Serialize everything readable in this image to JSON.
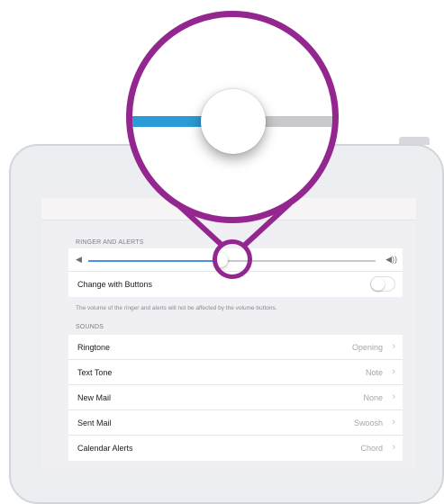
{
  "colors": {
    "accent": "#93278f",
    "slider_fill": "#4a90e2",
    "slider_track": "#c7c7cc"
  },
  "settings": {
    "ringer_header": "RINGER AND ALERTS",
    "volume_level": 0.46,
    "change_with_buttons_label": "Change with Buttons",
    "change_with_buttons_on": false,
    "footer_note": "The volume of the ringer and alerts will not be affected by the volume buttons.",
    "sounds_header": "SOUNDS",
    "sounds": [
      {
        "label": "Ringtone",
        "value": "Opening"
      },
      {
        "label": "Text Tone",
        "value": "Note"
      },
      {
        "label": "New Mail",
        "value": "None"
      },
      {
        "label": "Sent Mail",
        "value": "Swoosh"
      },
      {
        "label": "Calendar Alerts",
        "value": "Chord"
      }
    ]
  },
  "icons": {
    "volume_low": "speaker-low-icon",
    "volume_high": "speaker-high-icon",
    "chevron": "chevron-right-icon"
  }
}
